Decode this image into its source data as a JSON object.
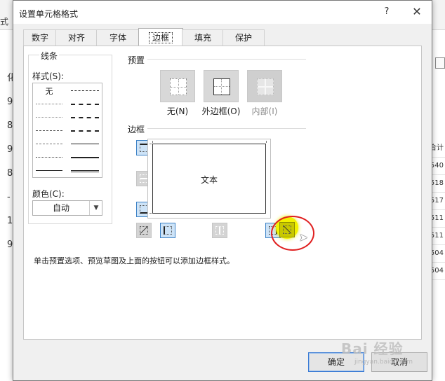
{
  "background": {
    "left_top_text": "式",
    "left_column": [
      "化",
      "9",
      "8",
      "9",
      "8",
      "-",
      "1",
      "9"
    ],
    "right_column": [
      "合计",
      "540",
      "518",
      "517",
      "511",
      "511",
      "504",
      "504"
    ]
  },
  "dialog": {
    "title": "设置单元格格式",
    "help": "?",
    "close": "✕"
  },
  "tabs": [
    {
      "label": "数字"
    },
    {
      "label": "对齐"
    },
    {
      "label": "字体"
    },
    {
      "label": "边框"
    },
    {
      "label": "填充"
    },
    {
      "label": "保护"
    }
  ],
  "active_tab": "边框",
  "line": {
    "legend": "线条",
    "style_label": "样式(S):",
    "none_label": "无",
    "color_label": "颜色(C):",
    "color_value": "自动"
  },
  "preset": {
    "title": "预置",
    "items": [
      {
        "label": "无(N)",
        "enabled": true
      },
      {
        "label": "外边框(O)",
        "enabled": true
      },
      {
        "label": "内部(I)",
        "enabled": false
      }
    ]
  },
  "border": {
    "title": "边框",
    "preview_text": "文本"
  },
  "hint": "单击预置选项、预览草图及上面的按钮可以添加边框样式。",
  "buttons": {
    "ok": "确定",
    "cancel": "取消"
  },
  "watermark": {
    "text": "Bai 经验",
    "url": "jingyan.baidu.com"
  }
}
